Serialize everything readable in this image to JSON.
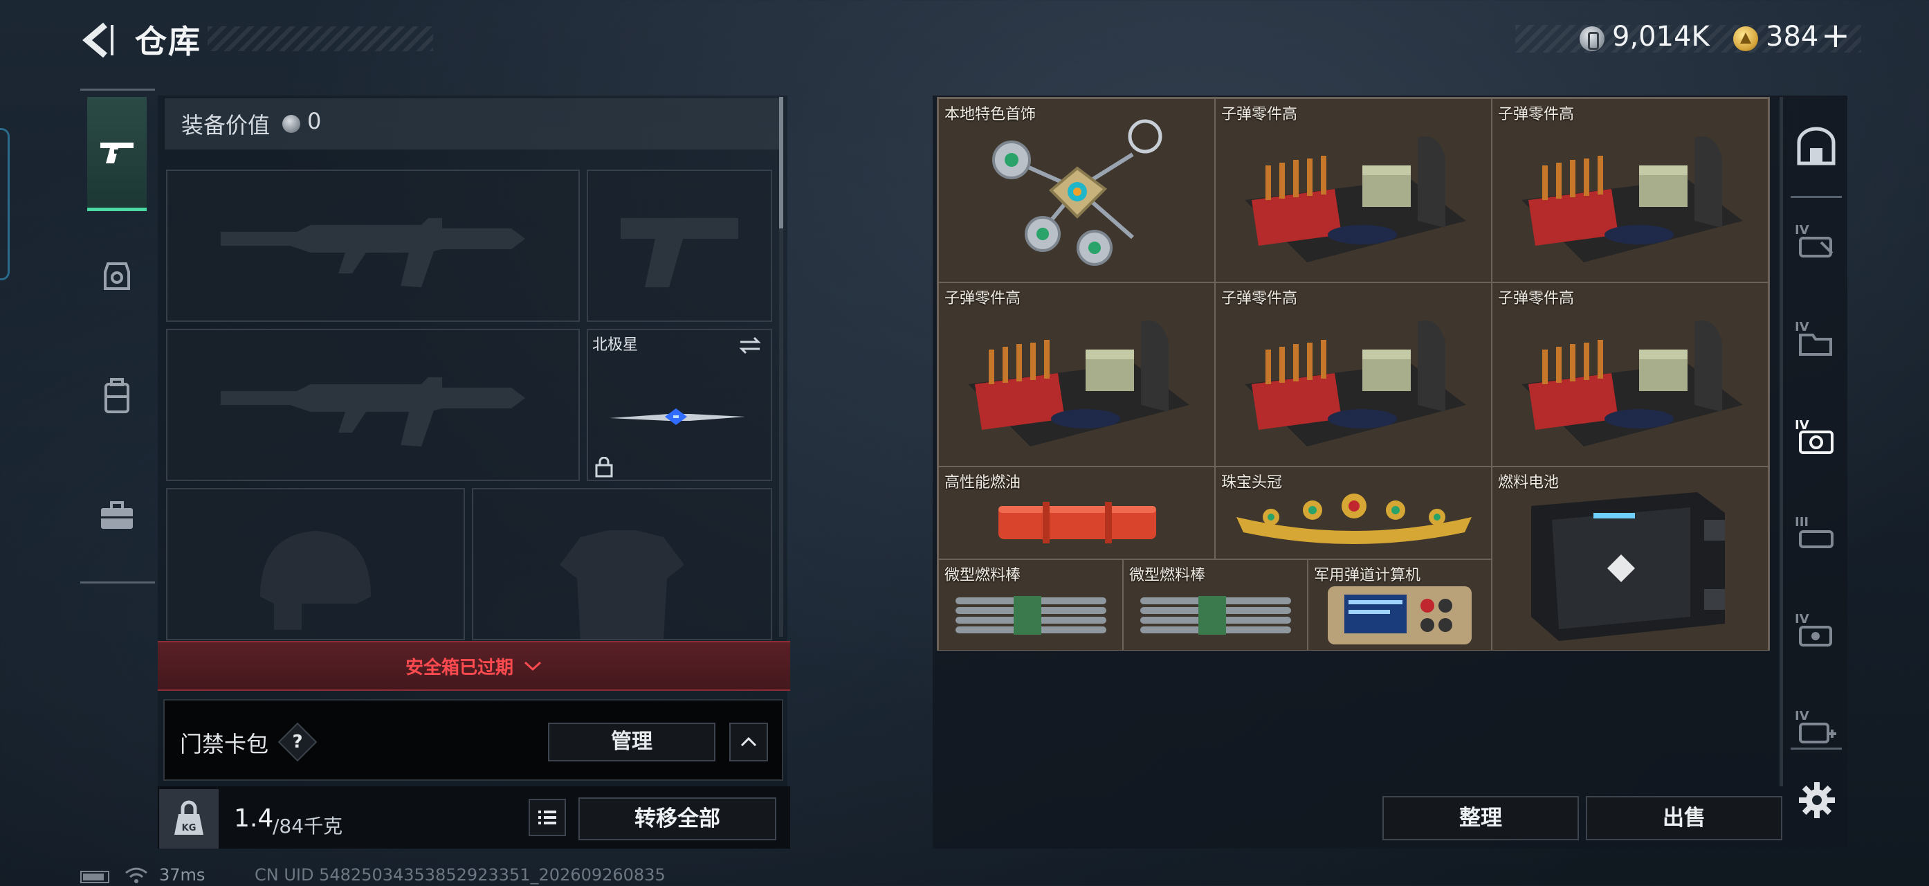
{
  "header": {
    "title": "仓库",
    "coins": "9,014K",
    "gold": "384",
    "gold_plus": "+"
  },
  "equipment": {
    "label": "装备价值",
    "value": "0",
    "knife_name": "北极星"
  },
  "safebox": {
    "status": "安全箱已过期"
  },
  "keycard": {
    "label": "门禁卡包",
    "help": "?",
    "manage": "管理"
  },
  "weight": {
    "current": "1.4",
    "rest": "/84千克",
    "transfer_all": "转移全部"
  },
  "storage": {
    "items": [
      {
        "label": "本地特色首饰",
        "icon": "jewelry-pendant"
      },
      {
        "label": "子弹零件高",
        "icon": "ammo-parts-crate"
      },
      {
        "label": "子弹零件高",
        "icon": "ammo-parts-crate"
      },
      {
        "label": "子弹零件高",
        "icon": "ammo-parts-crate"
      },
      {
        "label": "子弹零件高",
        "icon": "ammo-parts-crate"
      },
      {
        "label": "子弹零件高",
        "icon": "ammo-parts-crate"
      },
      {
        "label": "高性能燃油",
        "icon": "fuel-canister"
      },
      {
        "label": "珠宝头冠",
        "icon": "jeweled-crown"
      },
      {
        "label": "燃料电池",
        "icon": "fuel-cell"
      },
      {
        "label": "微型燃料棒",
        "icon": "fuel-rods"
      },
      {
        "label": "微型燃料棒",
        "icon": "fuel-rods"
      },
      {
        "label": "军用弹道计算机",
        "icon": "ballistic-computer"
      }
    ],
    "organize": "整理",
    "sell": "出售"
  },
  "status_bar": {
    "ping": "37ms",
    "uid": "CN UID 54825034353852923351_202609260835"
  },
  "colors": {
    "accent_green": "#4ad9a2",
    "alert_red": "#ff4b4f",
    "grid_brown": "#3f362d"
  }
}
